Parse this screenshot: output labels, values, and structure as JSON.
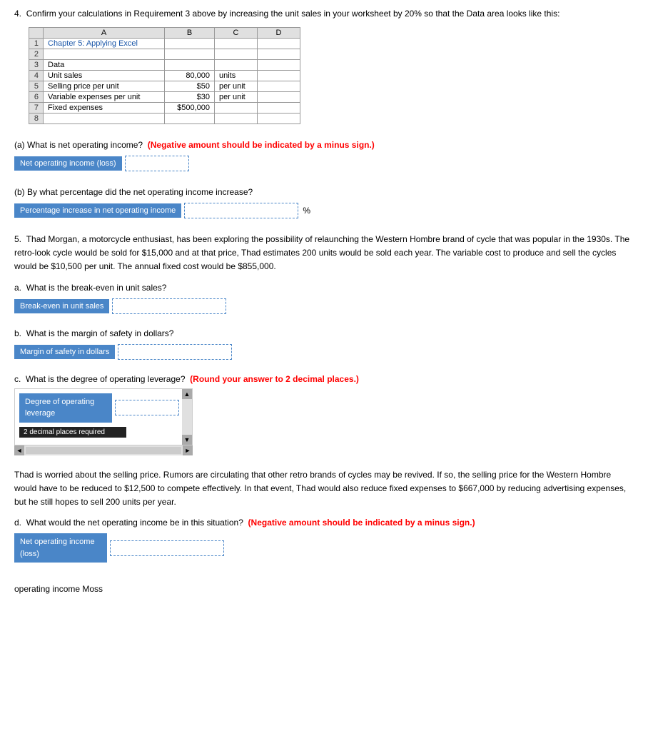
{
  "item4": {
    "label": "4.",
    "text": "Confirm your calculations in Requirement 3 above by increasing the unit sales in your worksheet by 20% so that the Data area looks like this:",
    "spreadsheet": {
      "headers": [
        "",
        "A",
        "B",
        "C",
        "D"
      ],
      "rows": [
        {
          "num": "1",
          "a": "Chapter 5: Applying Excel",
          "b": "",
          "c": "",
          "d": ""
        },
        {
          "num": "2",
          "a": "",
          "b": "",
          "c": "",
          "d": ""
        },
        {
          "num": "3",
          "a": "Data",
          "b": "",
          "c": "",
          "d": ""
        },
        {
          "num": "4",
          "a": "Unit sales",
          "b": "80,000",
          "c": "units",
          "d": ""
        },
        {
          "num": "5",
          "a": "Selling price per unit",
          "b": "$50",
          "c": "per unit",
          "d": ""
        },
        {
          "num": "6",
          "a": "Variable expenses per unit",
          "b": "$30",
          "c": "per unit",
          "d": ""
        },
        {
          "num": "7",
          "a": "Fixed expenses",
          "b": "$500,000",
          "c": "",
          "d": ""
        },
        {
          "num": "8",
          "a": "",
          "b": "",
          "c": "",
          "d": ""
        }
      ]
    }
  },
  "part_a": {
    "question": "(a) What is net operating income?",
    "red_text": "(Negative amount should be indicated by a minus sign.)",
    "label": "Net operating income (loss)",
    "input_placeholder": ""
  },
  "part_b": {
    "question": "(b) By what percentage did the net operating income increase?",
    "label": "Percentage increase in net operating income",
    "input_placeholder": "",
    "unit": "%"
  },
  "item5": {
    "label": "5.",
    "text": "Thad Morgan, a motorcycle enthusiast, has been exploring the possibility of relaunching the Western Hombre brand of cycle that was popular in the 1930s. The retro-look cycle would be sold for $15,000 and at that price, Thad estimates 200 units would be sold each year. The variable cost to produce and sell the cycles would be $10,500 per unit. The annual fixed cost would be $855,000."
  },
  "part_5a": {
    "label_letter": "a.",
    "question": "What is the break-even in unit sales?",
    "answer_label": "Break-even in unit sales",
    "input_placeholder": ""
  },
  "part_5b": {
    "label_letter": "b.",
    "question": "What is the margin of safety in dollars?",
    "answer_label": "Margin of safety in dollars",
    "input_placeholder": ""
  },
  "part_5c": {
    "label_letter": "c.",
    "question": "What is the degree of operating leverage?",
    "red_text": "(Round your answer to 2 decimal places.)",
    "answer_label_line1": "Degree of operating",
    "answer_label_line2": "leverage",
    "input_placeholder": "",
    "tooltip": "2 decimal places required"
  },
  "worried_text": "Thad is worried about the selling price. Rumors are circulating that other retro brands of cycles may be revived. If so, the selling price for the Western Hombre would have to be reduced to $12,500 to compete effectively. In that event, Thad would also reduce fixed expenses to $667,000 by reducing advertising expenses, but he still hopes to sell 200 units per year.",
  "part_5d": {
    "label_letter": "d.",
    "question": "What would the net operating income be in this situation?",
    "red_text": "(Negative amount should be indicated by a minus sign.)",
    "answer_label_line1": "Net operating income",
    "answer_label_line2": "(loss)",
    "input_placeholder": ""
  },
  "footer_text": "operating income Moss"
}
